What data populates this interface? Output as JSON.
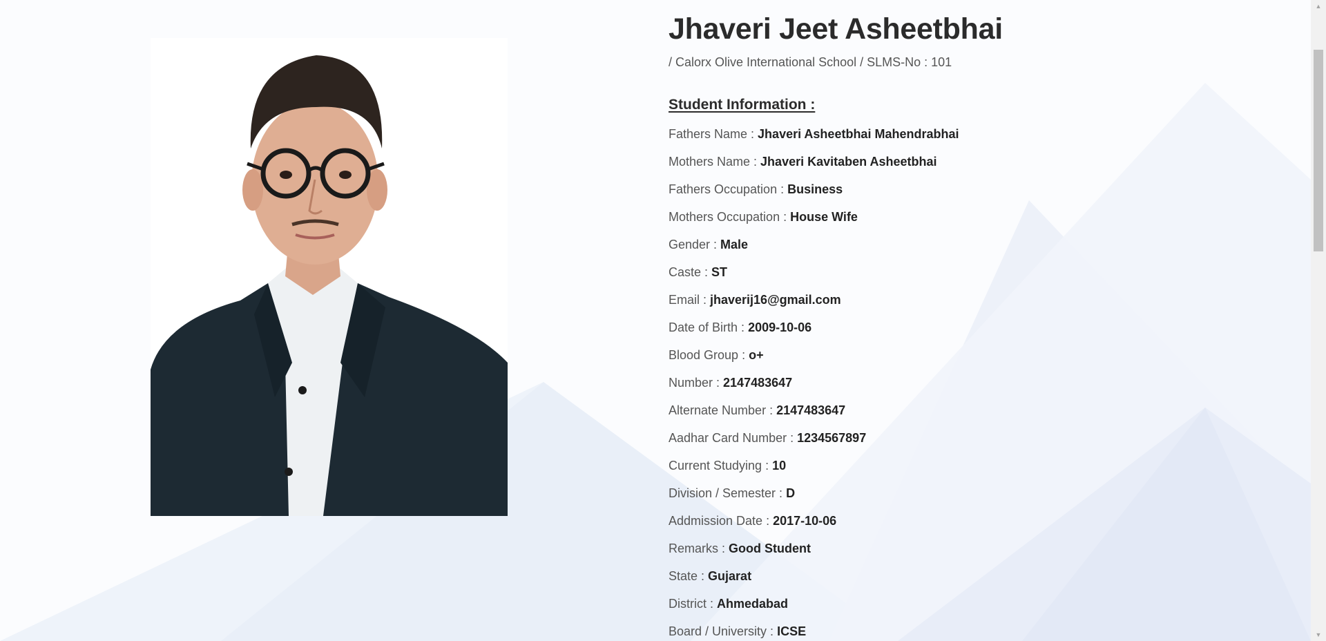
{
  "profile": {
    "name": "Jhaveri Jeet Asheetbhai",
    "subline": "/ Calorx Olive International School / SLMS-No : 101",
    "section_heading": "Student Information :",
    "fields": [
      {
        "label": "Fathers Name : ",
        "value": "Jhaveri Asheetbhai Mahendrabhai"
      },
      {
        "label": "Mothers Name : ",
        "value": "Jhaveri Kavitaben Asheetbhai"
      },
      {
        "label": "Fathers Occupation : ",
        "value": "Business"
      },
      {
        "label": "Mothers Occupation : ",
        "value": "House Wife"
      },
      {
        "label": "Gender : ",
        "value": "Male"
      },
      {
        "label": "Caste : ",
        "value": "ST"
      },
      {
        "label": "Email : ",
        "value": "jhaverij16@gmail.com"
      },
      {
        "label": "Date of Birth : ",
        "value": "2009-10-06"
      },
      {
        "label": "Blood Group : ",
        "value": "o+"
      },
      {
        "label": "Number : ",
        "value": "2147483647"
      },
      {
        "label": "Alternate Number : ",
        "value": "2147483647"
      },
      {
        "label": "Aadhar Card Number : ",
        "value": "1234567897"
      },
      {
        "label": "Current Studying : ",
        "value": "10"
      },
      {
        "label": "Division / Semester : ",
        "value": "D"
      },
      {
        "label": "Addmission Date : ",
        "value": "2017-10-06"
      },
      {
        "label": "Remarks : ",
        "value": "Good Student"
      },
      {
        "label": "State : ",
        "value": "Gujarat"
      },
      {
        "label": "District : ",
        "value": "Ahmedabad"
      },
      {
        "label": "Board / University : ",
        "value": "ICSE"
      }
    ]
  },
  "photo": {
    "icon": "student-photo"
  },
  "scrollbar": {
    "up_icon": "scroll-up-arrow-icon",
    "down_icon": "scroll-down-arrow-icon"
  },
  "colors": {
    "background": "#fbfcfe",
    "shape_light": "#edf2f9",
    "shape_mid": "#e6ecf6",
    "text_dark": "#2b2b2b",
    "text_label": "#555555"
  }
}
